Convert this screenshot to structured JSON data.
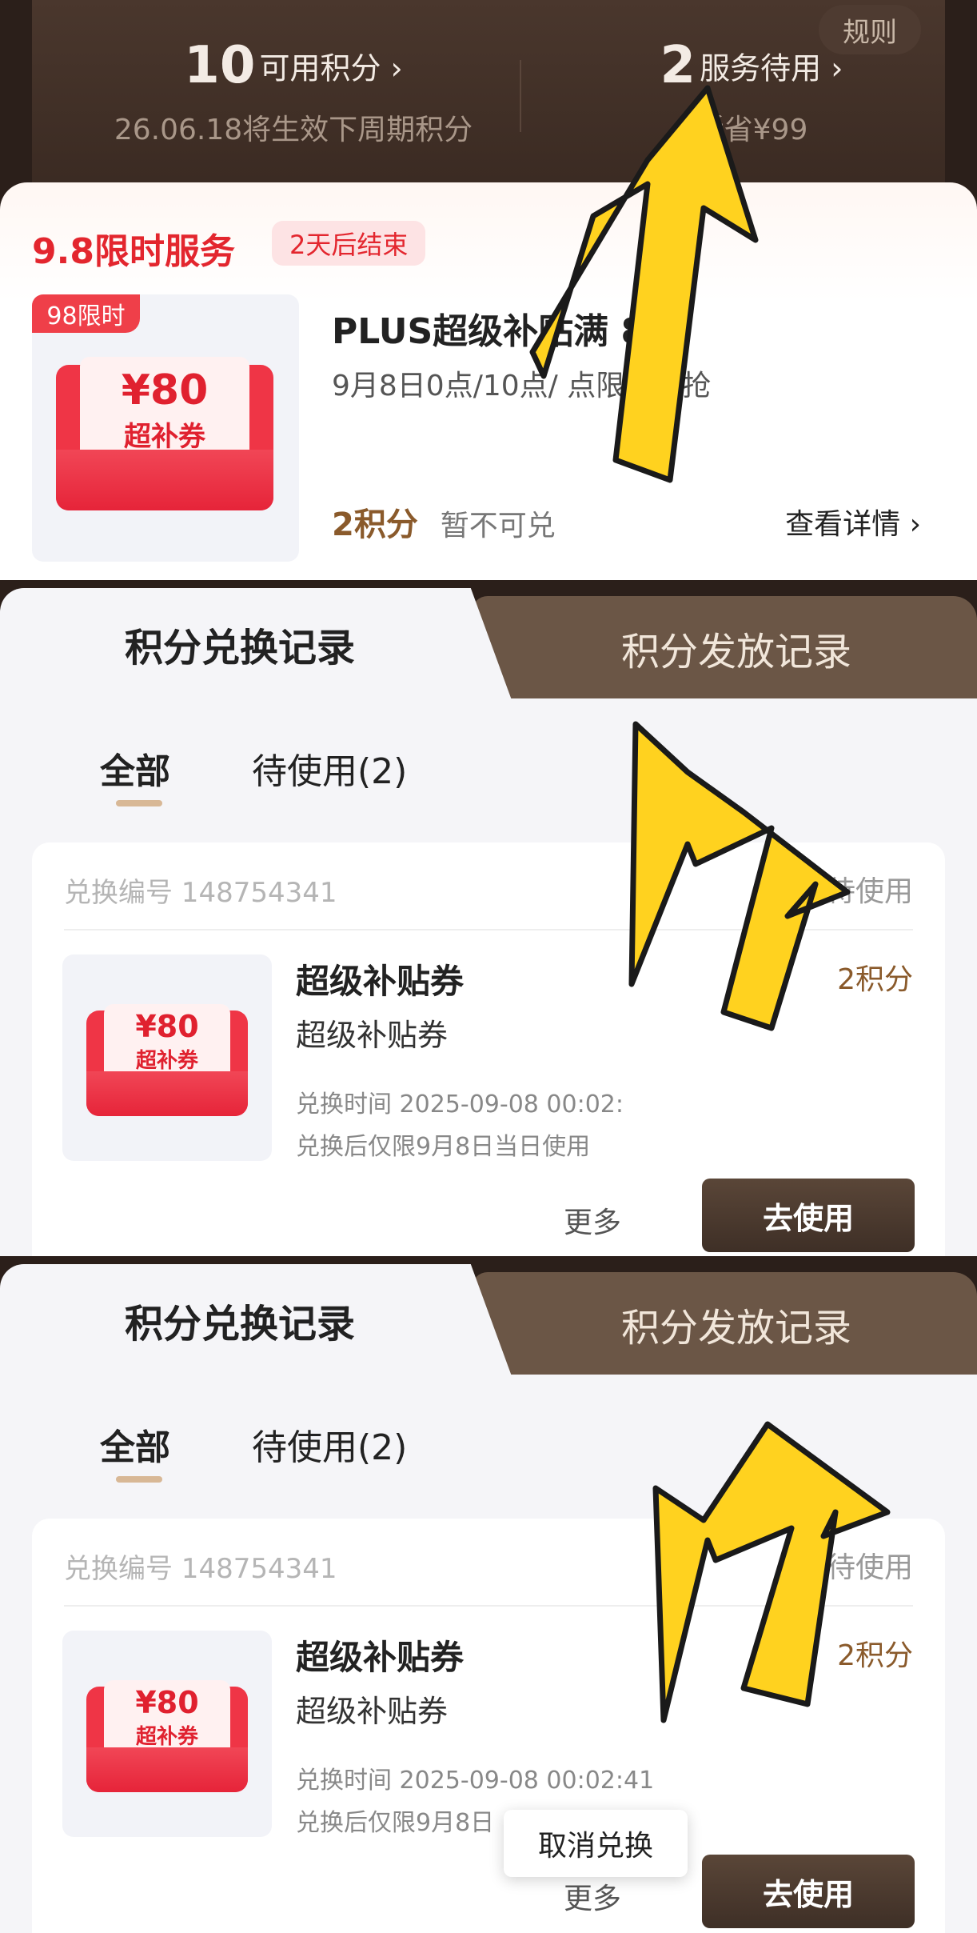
{
  "header": {
    "rule": "规则",
    "points_value": "10",
    "points_label": "可用积分 ›",
    "points_sub": "26.06.18将生效下周期积分",
    "service_value": "2",
    "service_label": "服务待用 ›",
    "service_sub": "近省¥99"
  },
  "offer": {
    "title": "9.8限时服务",
    "ends": "2天后结束",
    "limit_tag": "98限时",
    "coupon_value": "¥80",
    "coupon_label": "超补券",
    "name": "PLUS超级补贴满 80",
    "desc": "9月8日0点/10点/ 点限量开抢",
    "cost": "2积分",
    "cost_note": "暂不可兑",
    "detail": "查看详情 ›"
  },
  "records": [
    {
      "tab_active": "积分兑换记录",
      "tab_other": "积分发放记录",
      "sub_all": "全部",
      "sub_pending": "待使用(2)",
      "order_no": "兑换编号 148754341",
      "status": "待使用",
      "coupon_value": "¥80",
      "coupon_label": "超补券",
      "name": "超级补贴券",
      "subname": "超级补贴券",
      "cost": "2积分",
      "time": "兑换时间 2025-09-08 00:02:",
      "limit": "兑换后仅限9月8日当日使用",
      "more": "更多",
      "use": "去使用"
    },
    {
      "tab_active": "积分兑换记录",
      "tab_other": "积分发放记录",
      "sub_all": "全部",
      "sub_pending": "待使用(2)",
      "order_no": "兑换编号 148754341",
      "status": "待使用",
      "coupon_value": "¥80",
      "coupon_label": "超补券",
      "name": "超级补贴券",
      "subname": "超级补贴券",
      "cost": "2积分",
      "time": "兑换时间 2025-09-08 00:02:41",
      "limit": "兑换后仅限9月8日",
      "more": "更多",
      "use": "去使用",
      "popup": "取消兑换"
    }
  ],
  "colors": {
    "accent_red": "#e3262e",
    "brown_dark": "#3e2f26",
    "arrow_yellow": "#ffd21f"
  }
}
